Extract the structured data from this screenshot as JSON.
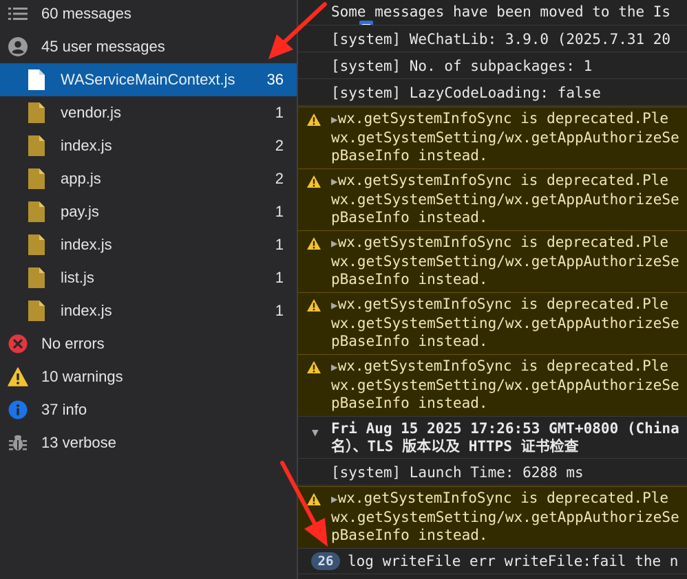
{
  "sidebar": {
    "summary": [
      {
        "icon": "list-icon",
        "label": "60 messages"
      },
      {
        "icon": "user-icon",
        "label": "45 user messages"
      }
    ],
    "files": [
      {
        "label": "WAServiceMainContext.js",
        "count": "36",
        "selected": true
      },
      {
        "label": "vendor.js",
        "count": "1"
      },
      {
        "label": "index.js",
        "count": "2"
      },
      {
        "label": "app.js",
        "count": "2"
      },
      {
        "label": "pay.js",
        "count": "1"
      },
      {
        "label": "index.js",
        "count": "1"
      },
      {
        "label": "list.js",
        "count": "1"
      },
      {
        "label": "index.js",
        "count": "1"
      }
    ],
    "levels": [
      {
        "icon": "error-icon",
        "label": "No errors",
        "color": "#e0383e"
      },
      {
        "icon": "warning-icon",
        "label": "10 warnings",
        "color": "#f2c231"
      },
      {
        "icon": "info-icon",
        "label": "37 info",
        "color": "#1a73e8"
      },
      {
        "icon": "bug-icon",
        "label": "13 verbose",
        "color": "#9a9a9a"
      }
    ]
  },
  "console": {
    "moved_notice": "Some messages have been moved to the Is",
    "system1": "[system] WeChatLib: 3.9.0 (2025.7.31 20",
    "system2": "[system] No. of subpackages: 1",
    "system3": "[system] LazyCodeLoading: false",
    "warning_lines": [
      "wx.getSystemInfoSync is deprecated.Ple",
      "wx.getSystemSetting/wx.getAppAuthorizeSe",
      "pBaseInfo instead."
    ],
    "group_line1": "Fri Aug 15 2025 17:26:53 GMT+0800 (China",
    "group_line2": "名）、TLS 版本以及 HTTPS 证书检查",
    "launch": "[system] Launch Time: 6288 ms",
    "log_badge": "26",
    "log_text": "log writeFile err writeFile:fail the n"
  }
}
